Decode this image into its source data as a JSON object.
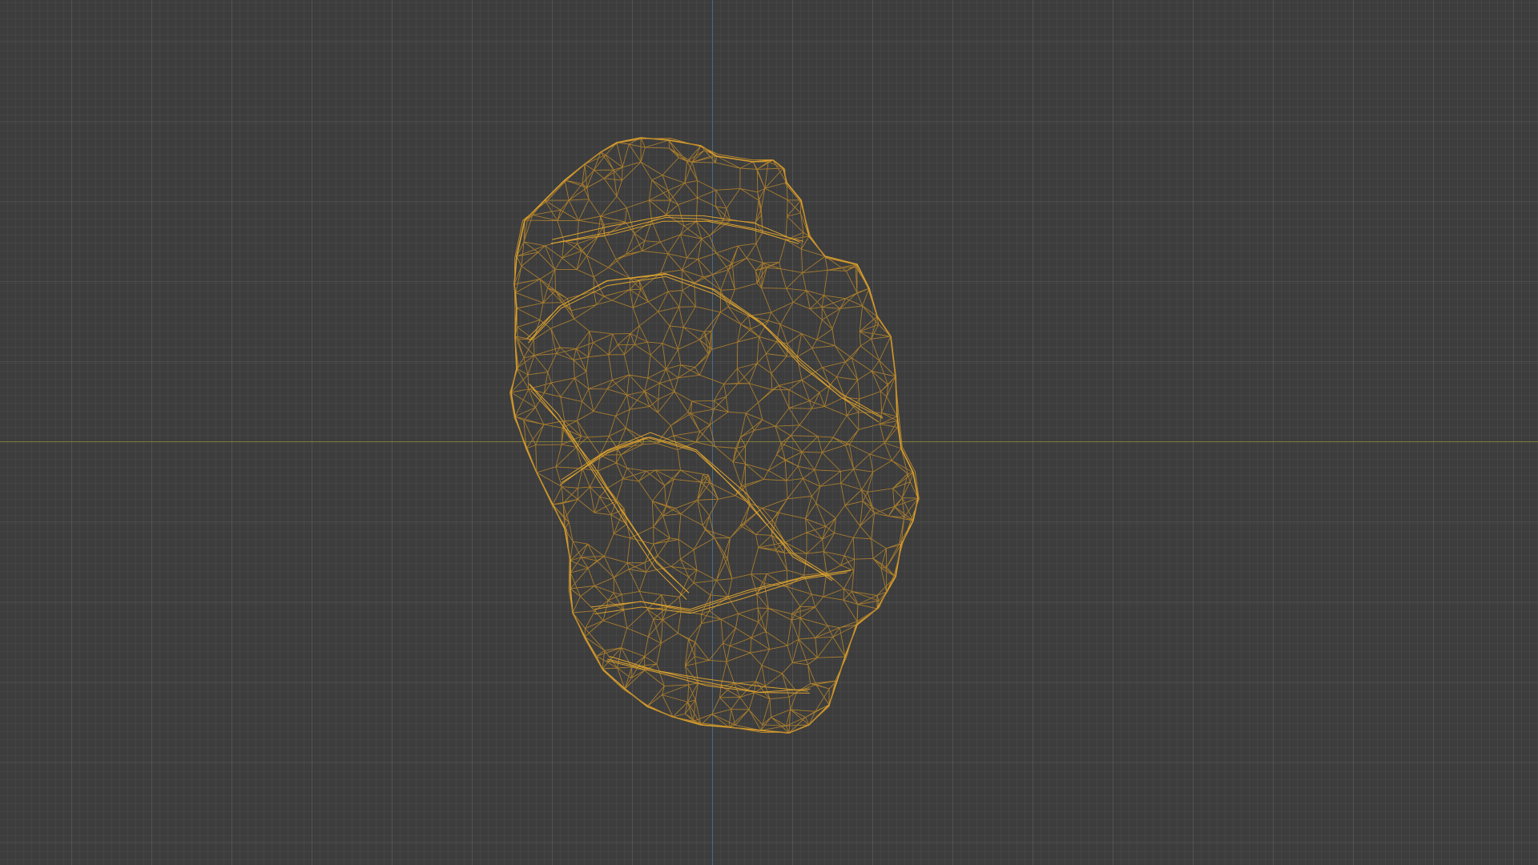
{
  "viewport": {
    "background_color": "#3d3d3d",
    "axis_x_color": "#7d7d3a",
    "axis_y_color": "#4a6a8a"
  },
  "mesh": {
    "icon": "wireframe-rock-mesh",
    "wire_color": "#d9a030",
    "wire_color_dim": "#b8862a"
  }
}
